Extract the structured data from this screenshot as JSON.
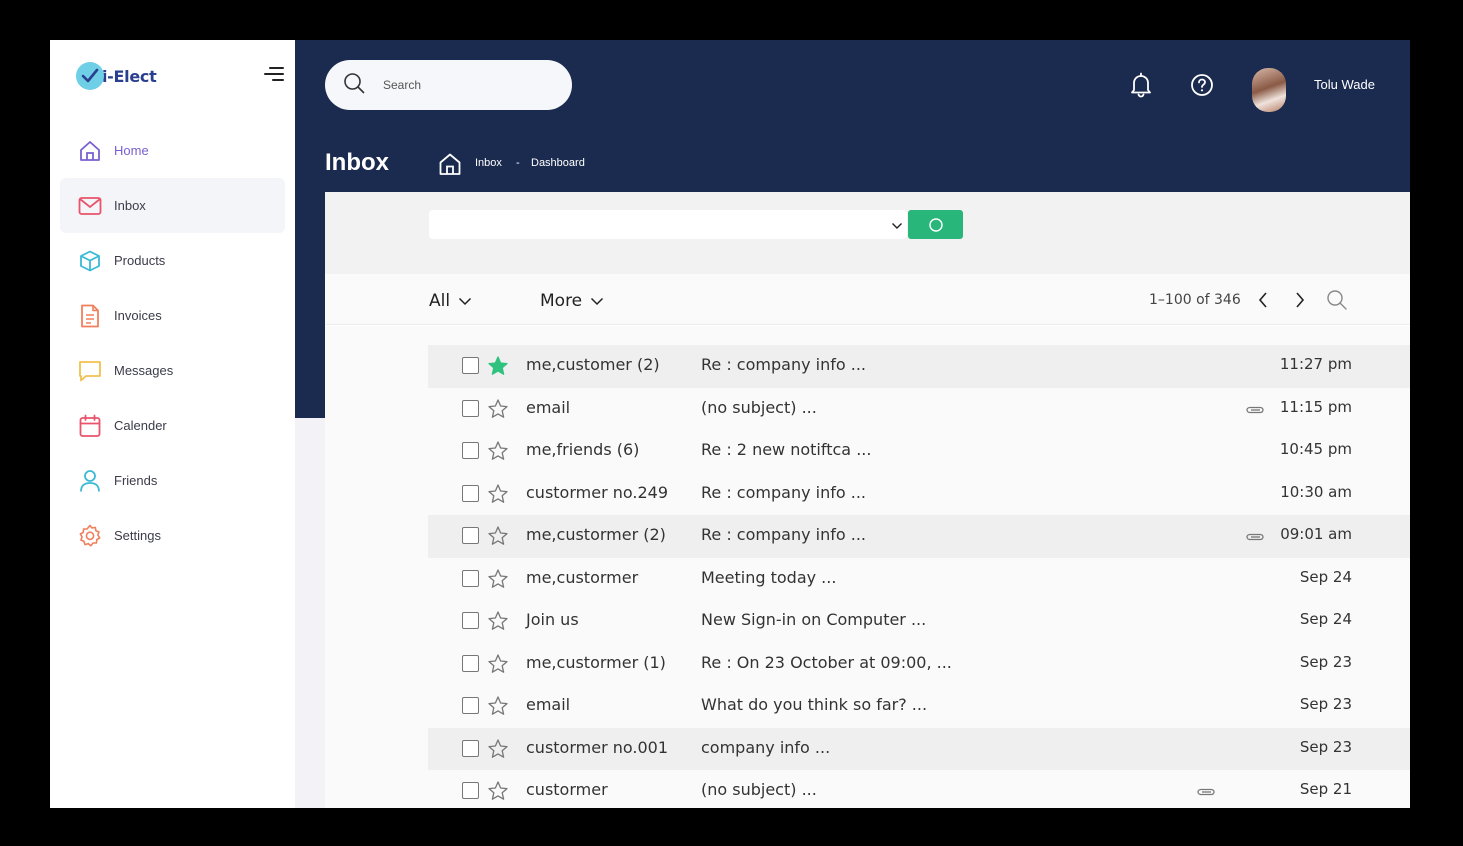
{
  "app": {
    "logo_text": "i-Elect"
  },
  "sidebar": {
    "items": [
      {
        "label": "Home",
        "icon": "home-icon"
      },
      {
        "label": "Inbox",
        "icon": "mail-icon"
      },
      {
        "label": "Products",
        "icon": "box-icon"
      },
      {
        "label": "Invoices",
        "icon": "document-icon"
      },
      {
        "label": "Messages",
        "icon": "chat-icon"
      },
      {
        "label": "Calender",
        "icon": "calendar-icon"
      },
      {
        "label": "Friends",
        "icon": "user-icon"
      },
      {
        "label": "Settings",
        "icon": "gear-icon"
      }
    ]
  },
  "header": {
    "search_placeholder": "Search",
    "user_name": "Tolu Wade",
    "page_title": "Inbox",
    "breadcrumb": [
      "Inbox",
      "-",
      "Dashboard"
    ]
  },
  "toolbar": {
    "all_label": "All",
    "more_label": "More",
    "pager": "1–100 of 346"
  },
  "emails": [
    {
      "sender": "me,customer (2)",
      "subject": "Re : company info ...",
      "time": "11:27 pm",
      "starred": true,
      "attachment": false,
      "highlighted": true
    },
    {
      "sender": "email",
      "subject": "(no subject) ...",
      "time": "11:15 pm",
      "starred": false,
      "attachment": true,
      "highlighted": false
    },
    {
      "sender": "me,friends (6)",
      "subject": "Re : 2 new notiftca ...",
      "time": "10:45 pm",
      "starred": false,
      "attachment": false,
      "highlighted": false
    },
    {
      "sender": "custormer no.249",
      "subject": "Re : company info ...",
      "time": "10:30 am",
      "starred": false,
      "attachment": false,
      "highlighted": false
    },
    {
      "sender": "me,custormer (2)",
      "subject": "Re : company info ...",
      "time": "09:01 am",
      "starred": false,
      "attachment": true,
      "highlighted": true
    },
    {
      "sender": "me,custormer",
      "subject": "Meeting today ...",
      "time": "Sep 24",
      "starred": false,
      "attachment": false,
      "highlighted": false
    },
    {
      "sender": "Join us",
      "subject": "New Sign-in on Computer ...",
      "time": "Sep 24",
      "starred": false,
      "attachment": false,
      "highlighted": false
    },
    {
      "sender": "me,custormer (1)",
      "subject": "Re : On 23 October at 09:00, ...",
      "time": "Sep 23",
      "starred": false,
      "attachment": false,
      "highlighted": false
    },
    {
      "sender": "email",
      "subject": "What do you think so far? ...",
      "time": "Sep 23",
      "starred": false,
      "attachment": false,
      "highlighted": false
    },
    {
      "sender": "custormer no.001",
      "subject": "company info ...",
      "time": "Sep 23",
      "starred": false,
      "attachment": false,
      "highlighted": true
    },
    {
      "sender": "custormer",
      "subject": "(no subject) ...",
      "time": "Sep 21",
      "starred": false,
      "attachment": true,
      "highlighted": false
    }
  ],
  "colors": {
    "header_bg": "#1b2b4f",
    "accent_green": "#28b67a",
    "star_active": "#2ec27e"
  }
}
